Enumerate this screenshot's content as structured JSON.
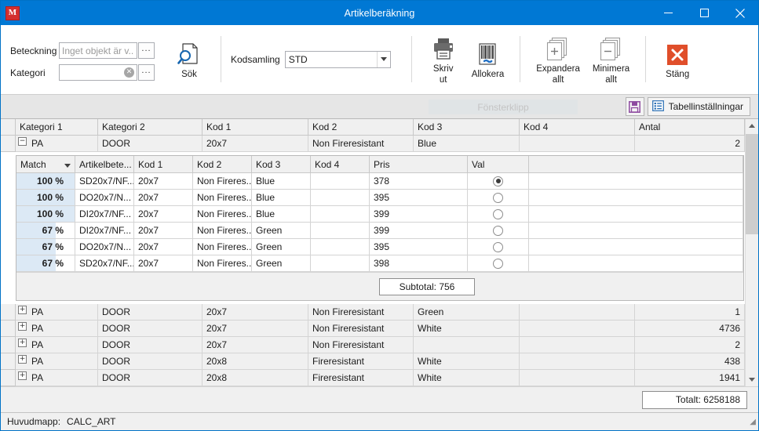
{
  "window": {
    "title": "Artikelberäkning",
    "app_icon": "app-logo-icon",
    "minimize_label": "Minimera",
    "maximize_label": "Maximera",
    "close_label": "Stäng"
  },
  "ribbon": {
    "fields": [
      {
        "label": "Beteckning",
        "value": "",
        "placeholder": "Inget objekt är v...",
        "has_clear": false
      },
      {
        "label": "Kategori",
        "value": "",
        "placeholder": "",
        "has_clear": true
      }
    ],
    "ellipsis_label": "...",
    "search_button": {
      "line1": "Sök",
      "line2": ""
    },
    "kodsamling": {
      "label": "Kodsamling",
      "value": "STD"
    },
    "buttons": [
      {
        "line1": "Skriv",
        "line2": "ut",
        "icon": "printer-icon"
      },
      {
        "line1": "Allokera",
        "line2": "",
        "icon": "barcode-link-icon"
      },
      {
        "line1": "Expandera",
        "line2": "allt",
        "icon": "expand-all-icon"
      },
      {
        "line1": "Minimera",
        "line2": "allt",
        "icon": "collapse-all-icon"
      },
      {
        "line1": "Stäng",
        "line2": "",
        "icon": "close-red-icon"
      }
    ],
    "close_accent": "#e04e2a"
  },
  "subbar": {
    "fonsterklipp": "Fönsterklipp",
    "save_icon": "save-icon",
    "save_accent": "#8e4ba0",
    "table_settings": "Tabellinställningar",
    "table_settings_icon": "table-settings-icon"
  },
  "grid": {
    "columns": [
      "Kategori 1",
      "Kategori 2",
      "Kod 1",
      "Kod 2",
      "Kod 3",
      "Kod 4",
      "Antal"
    ],
    "rows": [
      {
        "expanded": true,
        "cells": [
          "PA",
          "DOOR",
          "20x7",
          "Non Fireresistant",
          "Blue",
          "",
          "2"
        ]
      },
      {
        "expanded": false,
        "cells": [
          "PA",
          "DOOR",
          "20x7",
          "Non Fireresistant",
          "Green",
          "",
          "1"
        ]
      },
      {
        "expanded": false,
        "cells": [
          "PA",
          "DOOR",
          "20x7",
          "Non Fireresistant",
          "White",
          "",
          "4736"
        ]
      },
      {
        "expanded": false,
        "cells": [
          "PA",
          "DOOR",
          "20x7",
          "Non Fireresistant",
          "",
          "",
          "2"
        ]
      },
      {
        "expanded": false,
        "cells": [
          "PA",
          "DOOR",
          "20x8",
          "Fireresistant",
          "White",
          "",
          "438"
        ]
      },
      {
        "expanded": false,
        "cells": [
          "PA",
          "DOOR",
          "20x8",
          "Fireresistant",
          "White",
          "",
          "1941"
        ]
      }
    ],
    "expander_expanded": "−",
    "expander_collapsed": "+",
    "detail": {
      "columns": [
        "Match",
        "Artikelbete...",
        "Kod 1",
        "Kod 2",
        "Kod 3",
        "Kod 4",
        "Pris",
        "Val",
        ""
      ],
      "sorted_column": "Match",
      "rows": [
        {
          "match": "100 %",
          "match_pct": 100,
          "artikel": "SD20x7/NF...",
          "kod1": "20x7",
          "kod2": "Non Fireres...",
          "kod3": "Blue",
          "kod4": "",
          "pris": "378",
          "selected": true
        },
        {
          "match": "100 %",
          "match_pct": 100,
          "artikel": "DO20x7/N...",
          "kod1": "20x7",
          "kod2": "Non Fireres...",
          "kod3": "Blue",
          "kod4": "",
          "pris": "395",
          "selected": false
        },
        {
          "match": "100 %",
          "match_pct": 100,
          "artikel": "DI20x7/NF...",
          "kod1": "20x7",
          "kod2": "Non Fireres...",
          "kod3": "Blue",
          "kod4": "",
          "pris": "399",
          "selected": false
        },
        {
          "match": "67 %",
          "match_pct": 67,
          "artikel": "DI20x7/NF...",
          "kod1": "20x7",
          "kod2": "Non Fireres...",
          "kod3": "Green",
          "kod4": "",
          "pris": "399",
          "selected": false
        },
        {
          "match": "67 %",
          "match_pct": 67,
          "artikel": "DO20x7/N...",
          "kod1": "20x7",
          "kod2": "Non Fireres...",
          "kod3": "Green",
          "kod4": "",
          "pris": "395",
          "selected": false
        },
        {
          "match": "67 %",
          "match_pct": 67,
          "artikel": "SD20x7/NF...",
          "kod1": "20x7",
          "kod2": "Non Fireres...",
          "kod3": "Green",
          "kod4": "",
          "pris": "398",
          "selected": false
        }
      ],
      "subtotal": "Subtotal: 756"
    }
  },
  "footer": {
    "total": "Totalt: 6258188"
  },
  "statusbar": {
    "label": "Huvudmapp:",
    "value": "CALC_ART"
  }
}
